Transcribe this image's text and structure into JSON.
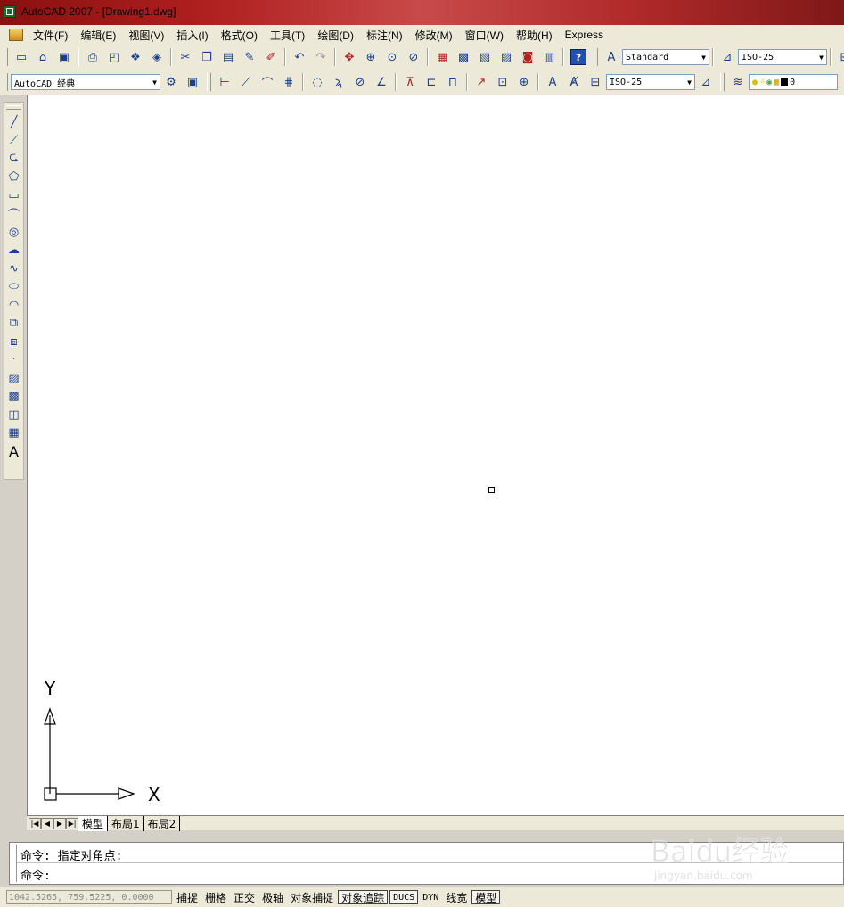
{
  "window": {
    "title": "AutoCAD 2007 - [Drawing1.dwg]"
  },
  "menu": [
    "文件(F)",
    "编辑(E)",
    "视图(V)",
    "插入(I)",
    "格式(O)",
    "工具(T)",
    "绘图(D)",
    "标注(N)",
    "修改(M)",
    "窗口(W)",
    "帮助(H)",
    "Express"
  ],
  "toolbar1": {
    "text_style": "Standard",
    "dim_style": "ISO-25"
  },
  "toolbar2": {
    "workspace": "AutoCAD 经典",
    "dim_style": "ISO-25",
    "layer": "0"
  },
  "drawing": {
    "ucs_y": "Y",
    "ucs_x": "X"
  },
  "tabs": [
    "模型",
    "布局1",
    "布局2"
  ],
  "command": {
    "history": "命令: 指定对角点:",
    "prompt": "命令:"
  },
  "status": {
    "coords": "1042.5265, 759.5225, 0.0000",
    "buttons": [
      "捕捉",
      "栅格",
      "正交",
      "极轴",
      "对象捕捉",
      "对象追踪",
      "DUCS",
      "DYN",
      "线宽",
      "模型"
    ]
  },
  "watermark": {
    "brand": "Baidu经验",
    "url": "jingyan.baidu.com"
  },
  "colors": {
    "title_bar": "#b02020",
    "chrome": "#ece9d8",
    "canvas": "#ffffff"
  }
}
